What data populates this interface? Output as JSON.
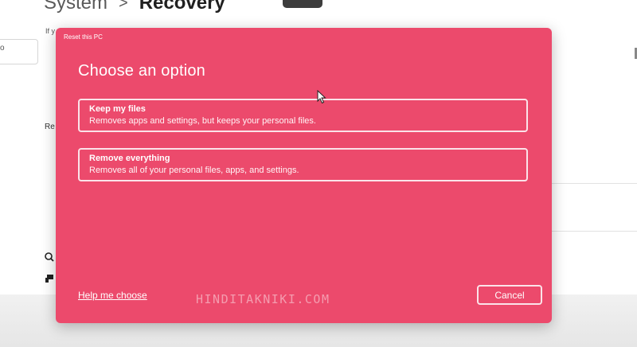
{
  "background": {
    "breadcrumb": {
      "parent": "System",
      "separator": ">",
      "current": "Recovery"
    },
    "subtext": "If y",
    "search_stub": "o",
    "recovery_label": "Re"
  },
  "dialog": {
    "window_title": "Reset this PC",
    "heading": "Choose an option",
    "options": [
      {
        "title": "Keep my files",
        "description": "Removes apps and settings, but keeps your personal files."
      },
      {
        "title": "Remove everything",
        "description": "Removes all of your personal files, apps, and settings."
      }
    ],
    "help_link": "Help me choose",
    "cancel_label": "Cancel"
  },
  "watermark": "HINDITAKNIKI.COM",
  "colors": {
    "dialog_background": "#ec4a6c",
    "dialog_border": "#fbe3e9",
    "page_background": "#ffffff"
  }
}
